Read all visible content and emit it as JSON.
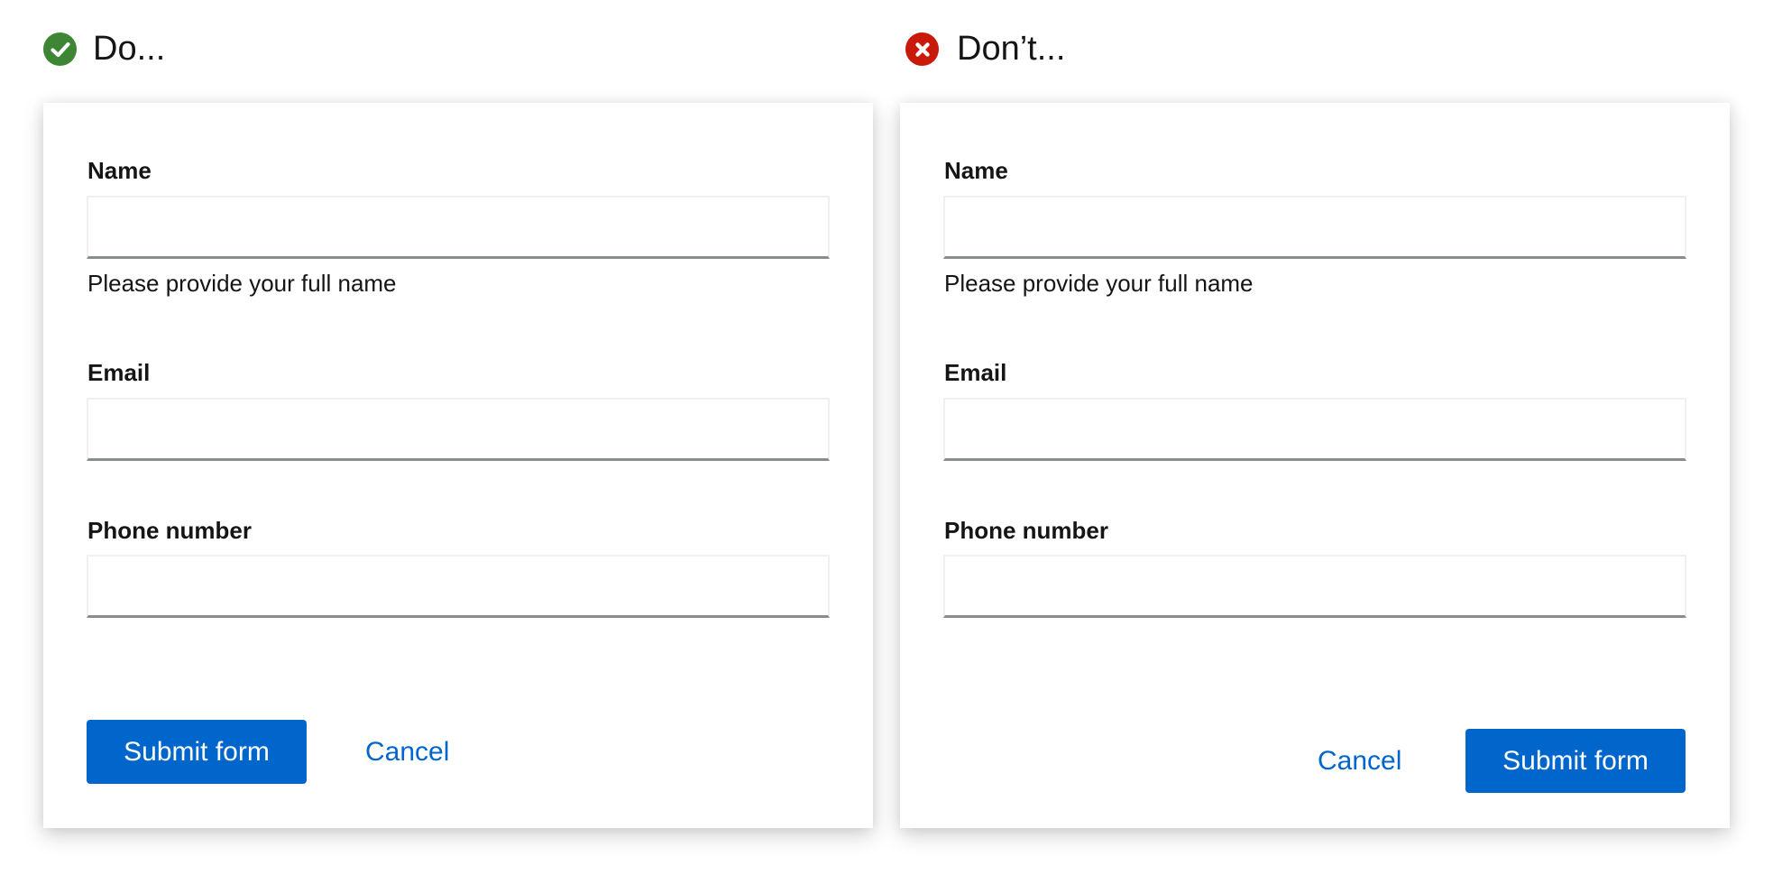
{
  "examples": {
    "do": {
      "title": "Do...",
      "icon": "check-circle-icon",
      "icon_color": "#3e8635"
    },
    "dont": {
      "title": "Don’t...",
      "icon": "times-circle-icon",
      "icon_color": "#c9190b"
    }
  },
  "form": {
    "fields": [
      {
        "label": "Name",
        "value": "",
        "placeholder": "",
        "helper_text": "Please provide your full name"
      },
      {
        "label": "Email",
        "value": "",
        "placeholder": ""
      },
      {
        "label": "Phone number",
        "value": "",
        "placeholder": ""
      }
    ],
    "actions": {
      "submit_label": "Submit form",
      "cancel_label": "Cancel"
    }
  },
  "colors": {
    "primary": "#0066cc",
    "success": "#3e8635",
    "danger": "#c9190b",
    "text": "#151515",
    "input_border_bottom": "#8a8d90"
  }
}
